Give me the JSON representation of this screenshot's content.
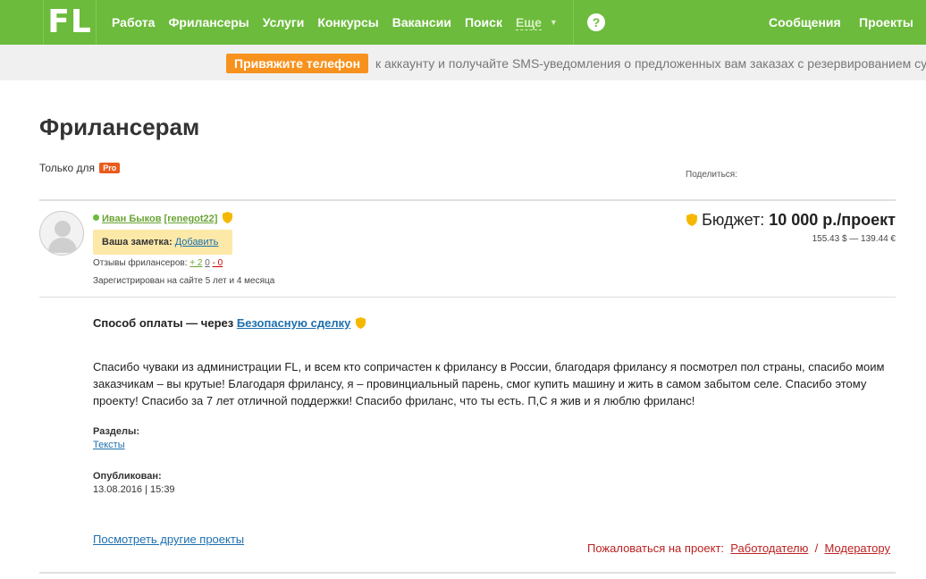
{
  "nav": {
    "logo": "FL",
    "items": [
      "Работа",
      "Фрилансеры",
      "Услуги",
      "Конкурсы",
      "Вакансии",
      "Поиск"
    ],
    "more": "Еще",
    "help": "?",
    "messages": "Сообщения",
    "projects": "Проекты"
  },
  "banner": {
    "button": "Привяжите телефон",
    "text": "к аккаунту и получайте SMS-уведомления о предложенных вам заказах с резервированием су"
  },
  "page": {
    "title": "Фрилансерам",
    "only_for": "Только для",
    "pro_badge": "Pro",
    "share": "Поделиться:"
  },
  "user": {
    "name": "Иван Быков",
    "login": "[renegot22]",
    "note_label": "Ваша заметка:",
    "note_link": "Добавить",
    "reviews_label": "Отзывы фрилансеров:",
    "reviews_positive": "+ 2",
    "reviews_neutral": "0",
    "reviews_negative": "- 0",
    "registered": "Зарегистрирован на сайте 5 лет и 4 месяца"
  },
  "budget": {
    "label": "Бюджет:",
    "amount": "10 000 р./проект",
    "conversion": "155.43 $ — 139.44 €"
  },
  "project": {
    "payment_prefix": "Способ оплаты — через",
    "payment_link": "Безопасную сделку",
    "description": "Спасибо чуваки из администрации FL, и всем кто сопричастен к фрилансу в России, благодаря фрилансу я посмотрел пол страны, спасибо моим заказчикам – вы крутые! Благодаря фрилансу, я – провинциальный парень, смог купить машину и жить в самом забытом селе. Спасибо этому проекту! Спасибо за 7 лет отличной поддержки! Спасибо фриланс, что ты есть. П,С я жив и я люблю фриланс!",
    "sections_label": "Разделы:",
    "sections_value": "Тексты",
    "published_label": "Опубликован:",
    "published_value": "13.08.2016 | 15:39",
    "other_projects": "Посмотреть другие проекты",
    "complain_label": "Пожаловаться на проект:",
    "complain_employer": "Работодателю",
    "complain_sep": "/",
    "complain_moderator": "Модератору"
  },
  "colors": {
    "brand_green": "#6cbb3c",
    "orange": "#f7921e",
    "link_blue": "#1e6fae",
    "shield_gold": "#f5b800"
  }
}
